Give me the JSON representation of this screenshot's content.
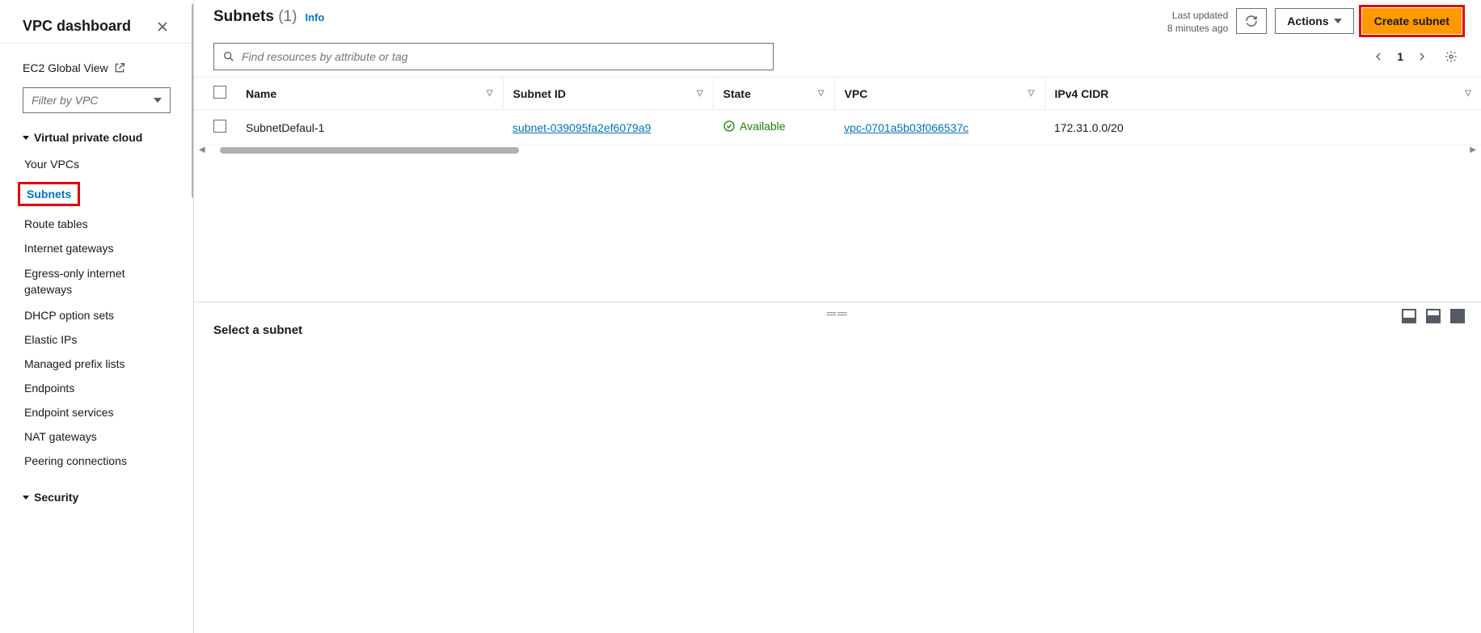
{
  "sidebar": {
    "title": "VPC dashboard",
    "ec2_global": "EC2 Global View",
    "filter_placeholder": "Filter by VPC",
    "section_vpc": "Virtual private cloud",
    "nav": {
      "your_vpcs": "Your VPCs",
      "subnets": "Subnets",
      "route_tables": "Route tables",
      "igw": "Internet gateways",
      "egress": "Egress-only internet gateways",
      "dhcp": "DHCP option sets",
      "eips": "Elastic IPs",
      "prefix": "Managed prefix lists",
      "endpoints": "Endpoints",
      "endpoint_svcs": "Endpoint services",
      "nat": "NAT gateways",
      "peering": "Peering connections"
    },
    "section_security": "Security"
  },
  "header": {
    "title": "Subnets",
    "count": "(1)",
    "info": "Info",
    "last_updated_label": "Last updated",
    "last_updated_value": "8 minutes ago",
    "actions_label": "Actions",
    "create_label": "Create subnet"
  },
  "search": {
    "placeholder": "Find resources by attribute or tag"
  },
  "pagination": {
    "page": "1"
  },
  "table": {
    "columns": {
      "name": "Name",
      "subnet_id": "Subnet ID",
      "state": "State",
      "vpc": "VPC",
      "ipv4": "IPv4 CIDR"
    },
    "rows": [
      {
        "name": "SubnetDefaul-1",
        "subnet_id": "subnet-039095fa2ef6079a9",
        "state": "Available",
        "vpc": "vpc-0701a5b03f066537c",
        "ipv4": "172.31.0.0/20"
      }
    ]
  },
  "details": {
    "empty_title": "Select a subnet"
  }
}
